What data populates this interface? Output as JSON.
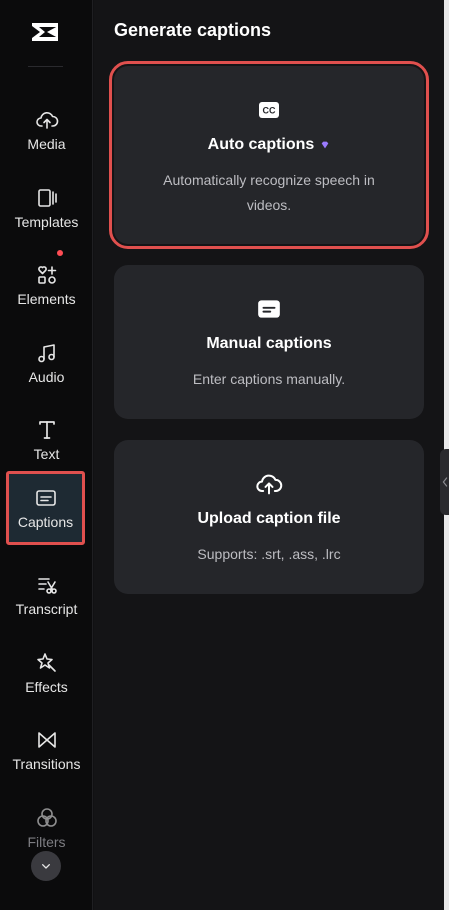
{
  "sidebar": {
    "items": [
      {
        "label": "Media",
        "icon": "upload-cloud-icon"
      },
      {
        "label": "Templates",
        "icon": "templates-icon"
      },
      {
        "label": "Elements",
        "icon": "elements-icon",
        "badge": true
      },
      {
        "label": "Audio",
        "icon": "music-note-icon"
      },
      {
        "label": "Text",
        "icon": "text-icon"
      },
      {
        "label": "Captions",
        "icon": "captions-icon",
        "active": true
      },
      {
        "label": "Transcript",
        "icon": "transcript-icon"
      },
      {
        "label": "Effects",
        "icon": "effects-star-icon"
      },
      {
        "label": "Transitions",
        "icon": "transitions-icon"
      },
      {
        "label": "Filters",
        "icon": "filters-icon"
      }
    ]
  },
  "panel": {
    "title": "Generate captions",
    "cards": [
      {
        "title": "Auto captions",
        "description": "Automatically recognize speech in videos.",
        "icon": "cc-icon",
        "premium_icon": "gem-icon"
      },
      {
        "title": "Manual captions",
        "description": "Enter captions manually.",
        "icon": "subtitles-icon"
      },
      {
        "title": "Upload caption file",
        "description": "Supports: .srt, .ass, .lrc",
        "icon": "cloud-upload-icon"
      }
    ]
  },
  "colors": {
    "highlight": "#e0504e",
    "badge": "#ff4d55",
    "premium": "#9b7bff"
  }
}
